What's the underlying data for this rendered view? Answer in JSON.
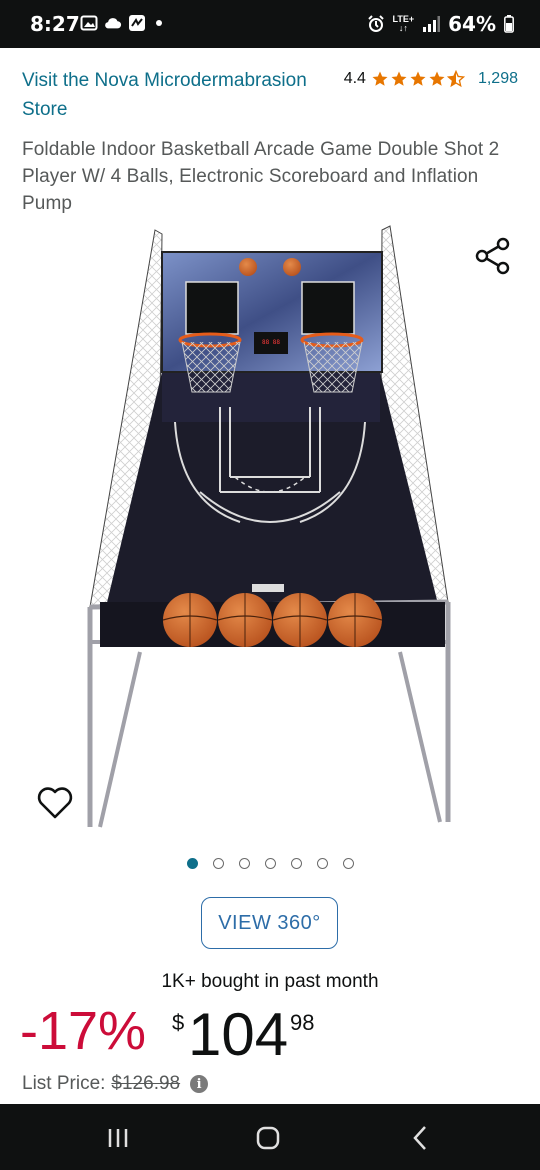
{
  "status_bar": {
    "time": "8:27",
    "battery": "64%",
    "network": "LTE+"
  },
  "store": {
    "link": "Visit the Nova Microdermabrasion Store"
  },
  "rating": {
    "value": "4.4",
    "stars": 4.4,
    "count": "1,298",
    "star_color": "#e77600"
  },
  "product": {
    "title": "Foldable Indoor Basketball Arcade Game Double Shot 2 Player W/ 4 Balls, Electronic Scoreboard and Inflation Pump"
  },
  "gallery": {
    "total_images": 7,
    "active_index": 0
  },
  "view360": {
    "label": "VIEW 360°"
  },
  "social_proof": {
    "bought": "1K+ bought in past month"
  },
  "price": {
    "discount": "-17%",
    "symbol": "$",
    "whole": "104",
    "fraction": "98",
    "list_label": "List Price:",
    "list_value": "$126.98",
    "discount_color": "#cc0c39"
  },
  "icons": {
    "share": "share-icon",
    "wishlist": "heart-icon",
    "info": "info-icon"
  }
}
